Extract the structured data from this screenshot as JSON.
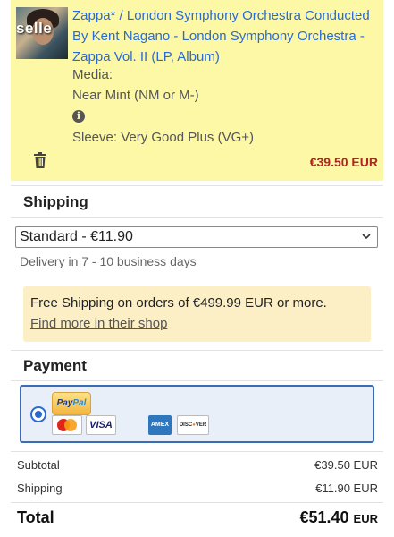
{
  "item": {
    "thumbnail_text": "selle",
    "title": "Zappa* / London Symphony Orchestra Conducted By Kent Nagano - London Symphony Orchestra - Zappa Vol. II (LP, Album)",
    "media_label": "Media:",
    "media_condition": "Near Mint (NM or M-)",
    "sleeve": "Sleeve: Very Good Plus (VG+)",
    "price": "€39.50 EUR",
    "info_icon": "info-icon",
    "delete_icon": "trash-icon"
  },
  "shipping": {
    "heading": "Shipping",
    "selected_option": "Standard - €11.90",
    "delivery": "Delivery in 7 - 10 business days",
    "notice_text": "Free Shipping on orders of €499.99 EUR or more.",
    "notice_link": "Find more in their shop"
  },
  "payment": {
    "heading": "Payment",
    "method": "PayPal",
    "cards": [
      "MasterCard",
      "VISA",
      "AMEX",
      "DISCOVER"
    ]
  },
  "summary": {
    "subtotal_label": "Subtotal",
    "subtotal_value": "€39.50 EUR",
    "shipping_label": "Shipping",
    "shipping_value": "€11.90 EUR",
    "total_label": "Total",
    "total_amount": "€51.40",
    "total_currency": "EUR"
  },
  "colors": {
    "item_bg": "#fdf8a6",
    "link_blue": "#2a6ad3",
    "price_red": "#b22424",
    "notice_bg": "#fcefc6",
    "payment_border": "#3b6db7"
  }
}
